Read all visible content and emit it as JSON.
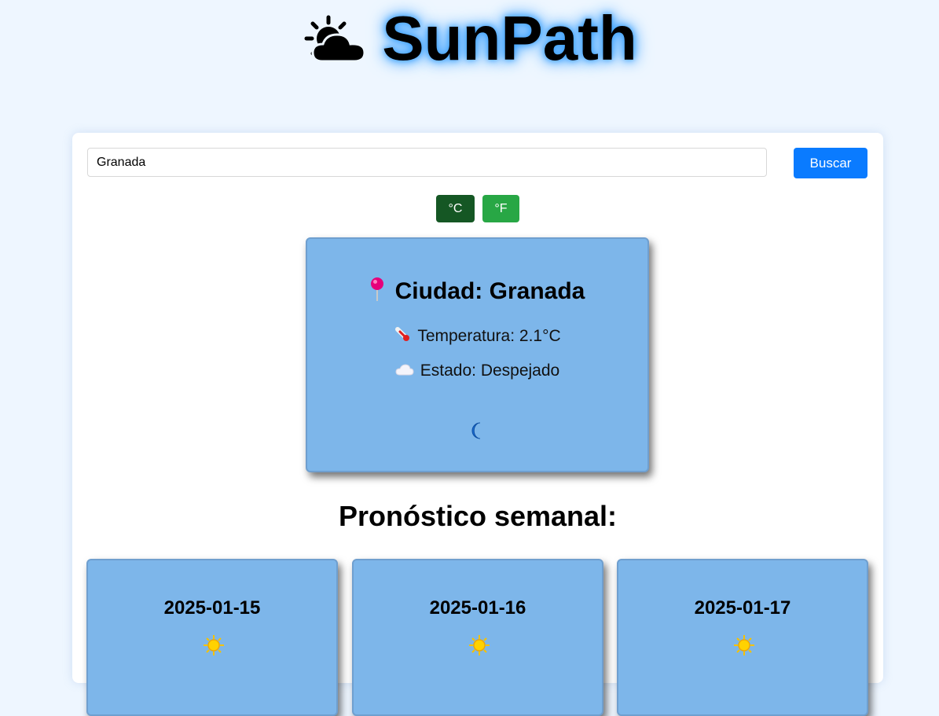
{
  "app": {
    "title": "SunPath",
    "logo_icon": "sun-behind-cloud-icon"
  },
  "search": {
    "value": "Granada",
    "placeholder": "",
    "button_label": "Buscar"
  },
  "units": {
    "celsius_label": "°C",
    "fahrenheit_label": "°F",
    "active": "°C"
  },
  "current": {
    "city_label": "Ciudad: Granada",
    "temperature_label": "Temperatura: 2.1°C",
    "state_label": "Estado: Despejado",
    "city_icon": "pushpin-icon",
    "temperature_icon": "thermometer-icon",
    "state_icon": "cloud-icon",
    "night_icon": "crescent-moon-icon"
  },
  "forecast": {
    "title": "Pronóstico semanal:",
    "days": [
      {
        "date": "2025-01-15",
        "icon": "sun-icon"
      },
      {
        "date": "2025-01-16",
        "icon": "sun-icon"
      },
      {
        "date": "2025-01-17",
        "icon": "sun-icon"
      }
    ]
  },
  "colors": {
    "background": "#eef6ff",
    "card": "#7db6ea",
    "primary_button": "#0a7bff",
    "celsius_button": "#155724",
    "fahrenheit_button": "#28a745"
  }
}
